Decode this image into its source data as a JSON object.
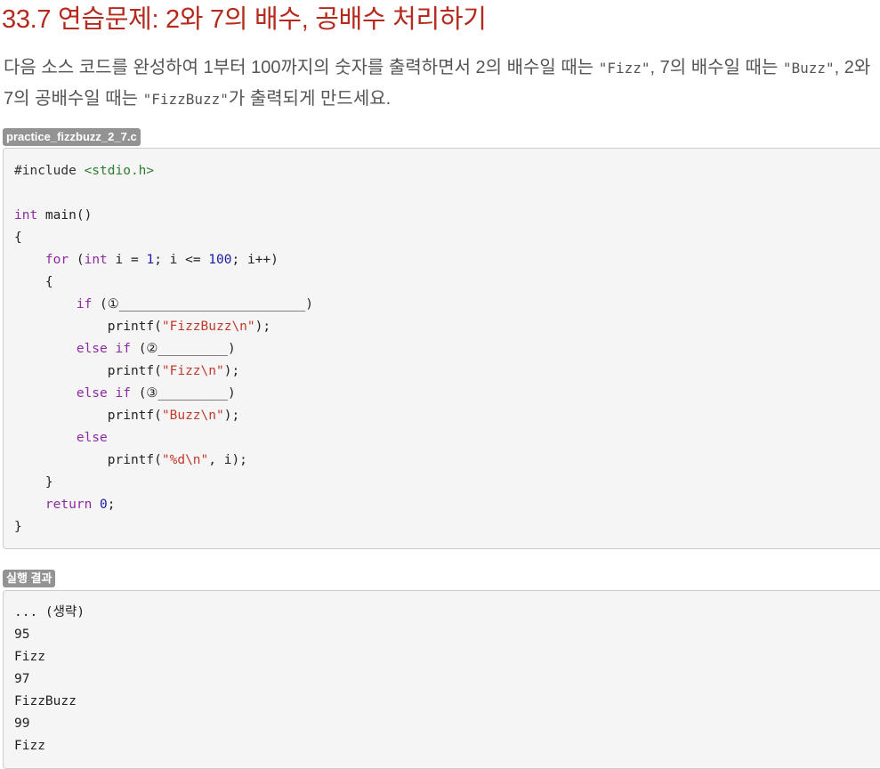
{
  "title": "33.7 연습문제: 2와 7의 배수, 공배수 처리하기",
  "description": {
    "part1": "다음 소스 코드를 완성하여 1부터 100까지의 숫자를 출력하면서 2의 배수일 때는 ",
    "fizz": "\"Fizz\"",
    "part2": ", 7의 배수일 때는 ",
    "buzz": "\"Buzz\"",
    "part3": ", 2와 7의 공배수일 때는 ",
    "fizzbuzz": "\"FizzBuzz\"",
    "part4": "가 출력되게 만드세요."
  },
  "source": {
    "filename": "practice_fizzbuzz_2_7.c",
    "lines": {
      "l1_prep": "#include ",
      "l1_inc": "<stdio.h>",
      "l3_type": "int",
      "l3_rest": " main()",
      "l4": "{",
      "l5_indent": "    ",
      "l5_for": "for",
      "l5_a": " (",
      "l5_int": "int",
      "l5_b": " i = ",
      "l5_one": "1",
      "l5_c": "; i <= ",
      "l5_hundred": "100",
      "l5_d": "; i++)",
      "l6": "    {",
      "l7_indent": "        ",
      "l7_if": "if",
      "l7_rest": " (①________________________)",
      "l8_a": "            printf(",
      "l8_str": "\"FizzBuzz\\n\"",
      "l8_b": ");",
      "l9_indent": "        ",
      "l9_else": "else",
      "l9_sp": " ",
      "l9_if": "if",
      "l9_rest": " (②_________)",
      "l10_a": "            printf(",
      "l10_str": "\"Fizz\\n\"",
      "l10_b": ");",
      "l11_indent": "        ",
      "l11_else": "else",
      "l11_sp": " ",
      "l11_if": "if",
      "l11_rest": " (③_________)",
      "l12_a": "            printf(",
      "l12_str": "\"Buzz\\n\"",
      "l12_b": ");",
      "l13_indent": "        ",
      "l13_else": "else",
      "l14_a": "            printf(",
      "l14_str": "\"%d\\n\"",
      "l14_b": ", i);",
      "l15": "    }",
      "l16_indent": "    ",
      "l16_return": "return",
      "l16_sp": " ",
      "l16_zero": "0",
      "l16_semi": ";",
      "l17": "}"
    }
  },
  "result": {
    "label": "실행 결과",
    "lines": [
      "... (생략)",
      "95",
      "Fizz",
      "97",
      "FizzBuzz",
      "99",
      "Fizz"
    ]
  }
}
